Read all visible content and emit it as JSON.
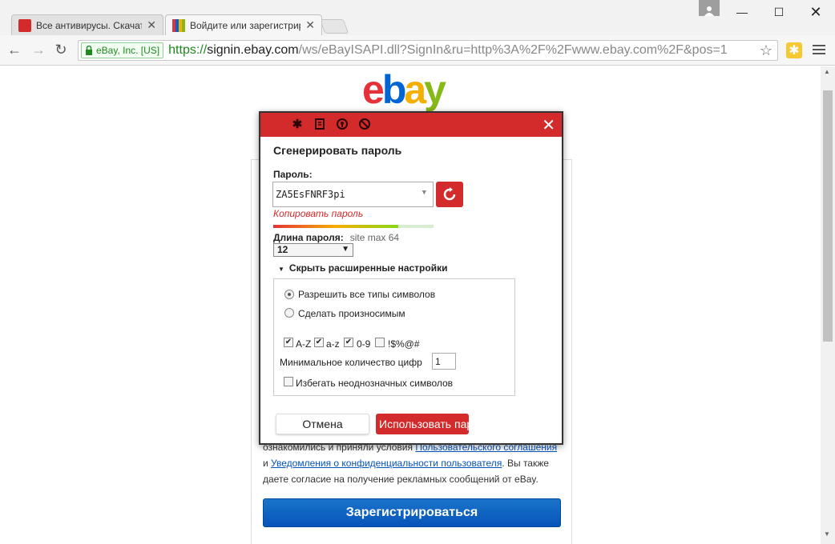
{
  "browser": {
    "tabs": [
      {
        "title": "Все антивирусы. Скачать",
        "active": false
      },
      {
        "title": "Войдите или зарегистрир",
        "active": true
      }
    ],
    "address": {
      "ev_label": "eBay, Inc. [US]",
      "scheme": "https://",
      "host": "signin.ebay.com",
      "path": "/ws/eBayISAPI.dll?SignIn&ru=http%3A%2F%2Fwww.ebay.com%2F&pos=1"
    },
    "colors": {
      "secure_green": "#1e8a1e",
      "ext_yellow": "#f6c932"
    }
  },
  "page": {
    "logo": [
      "e",
      "b",
      "a",
      "y"
    ],
    "terms": {
      "line1_prefix": "ознакомились и приняли условия ",
      "line1_link": "Пользовательского соглашения",
      "line2_prefix": "и ",
      "line2_link": "Уведомления о конфиденциальности пользователя",
      "line2_suffix": ". Вы также",
      "line3": "даете согласие на получение рекламных сообщений от eBay."
    },
    "register_button": "Зарегистрироваться",
    "colors": {
      "button_blue": "#0654ba",
      "link_blue": "#0654ba"
    }
  },
  "dialog": {
    "title": "Сгенерировать пароль",
    "password_label": "Пароль:",
    "password_value": "ZA5EsFNRF3pi",
    "copy_link": "Копировать пароль",
    "strength_fraction": 0.78,
    "length_label": "Длина пароля:",
    "site_max": "site max 64",
    "length_value": "12",
    "advanced_toggle": "Скрыть расширенные настройки",
    "options": {
      "all_types": "Разрешить все типы символов",
      "pronounceable": "Сделать произносимым",
      "selected": "all_types"
    },
    "charsets": [
      {
        "label": "A-Z",
        "checked": true
      },
      {
        "label": "a-z",
        "checked": true
      },
      {
        "label": "0-9",
        "checked": true
      },
      {
        "label": "!$%@#",
        "checked": false
      }
    ],
    "min_digits_label": "Минимальное количество цифр",
    "min_digits_value": "1",
    "avoid_ambiguous": {
      "label": "Избегать неоднозначных символов",
      "checked": false
    },
    "cancel_button": "Отмена",
    "use_button": "Использовать пароль",
    "header_icons": [
      "asterisk-icon",
      "notes-icon",
      "password-generator-icon",
      "block-icon"
    ],
    "colors": {
      "header_red": "#d32b2b"
    }
  }
}
